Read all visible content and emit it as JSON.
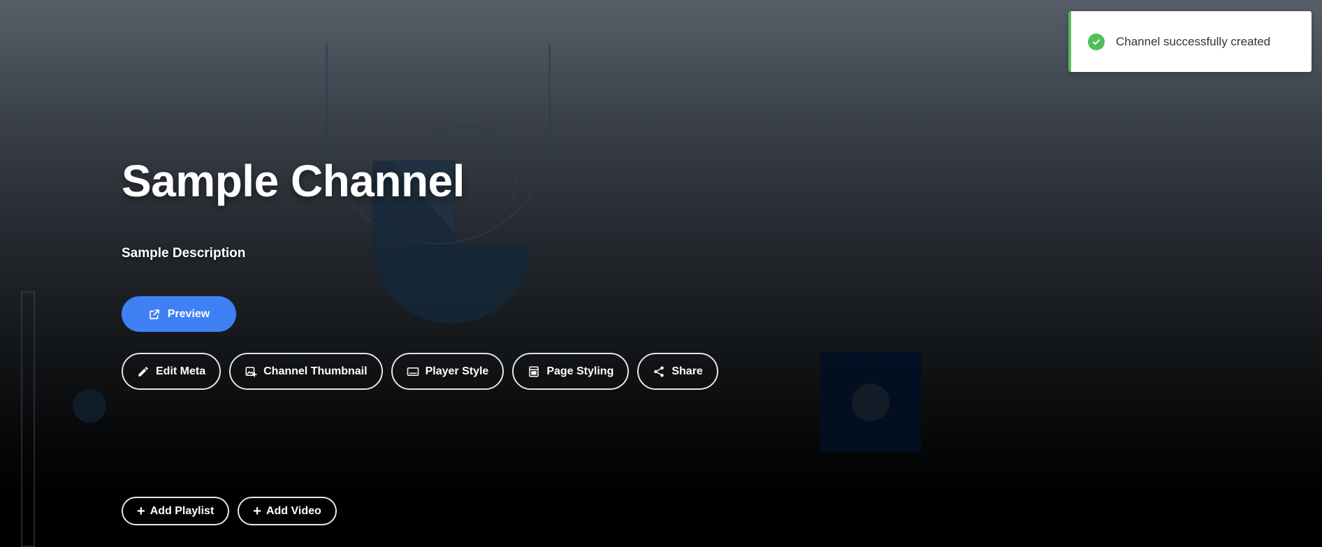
{
  "channel": {
    "title": "Sample Channel",
    "description": "Sample Description"
  },
  "actions": {
    "preview_label": "Preview",
    "buttons": [
      {
        "label": "Edit Meta",
        "icon": "pencil-icon"
      },
      {
        "label": "Channel Thumbnail",
        "icon": "image-add-icon"
      },
      {
        "label": "Player Style",
        "icon": "player-icon"
      },
      {
        "label": "Page Styling",
        "icon": "page-style-icon"
      },
      {
        "label": "Share",
        "icon": "share-icon"
      }
    ],
    "add_playlist_label": "Add Playlist",
    "add_video_label": "Add Video"
  },
  "toast": {
    "message": "Channel successfully created",
    "status": "success",
    "icon": "check-circle-icon"
  },
  "colors": {
    "accent": "#3f80f5",
    "success": "#5cb85c"
  }
}
